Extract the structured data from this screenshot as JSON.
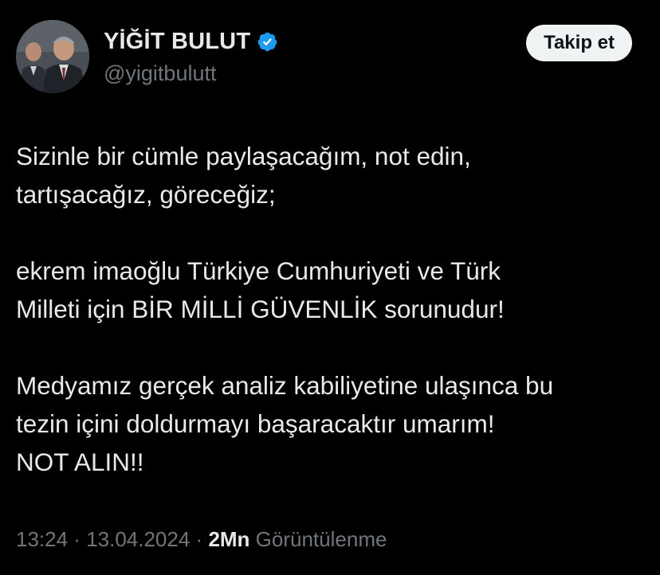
{
  "user": {
    "display_name": "YİĞİT BULUT",
    "handle": "@yigitbulutt",
    "verified_icon": "verified-badge-icon",
    "verified_color": "#1d9bf0"
  },
  "follow_button": {
    "label": "Takip et"
  },
  "tweet": {
    "lines_p1": [
      "Sizinle bir cümle paylaşacağım, not edin,",
      "tartışacağız, göreceğiz;"
    ],
    "lines_p2": [
      "ekrem imaoğlu Türkiye Cumhuriyeti ve Türk",
      "Milleti için BİR MİLLİ GÜVENLİK sorunudur!"
    ],
    "lines_p3": [
      "Medyamız gerçek analiz kabiliyetine ulaşınca bu",
      "tezin içini doldurmayı başaracaktır umarım!",
      "NOT ALIN!!"
    ]
  },
  "meta": {
    "time": "13:24",
    "separator": " · ",
    "date": "13.04.2024",
    "views_count": "2Mn",
    "views_label": "Görüntülenme"
  },
  "colors": {
    "background": "#000000",
    "text_primary": "#e7e9ea",
    "text_secondary": "#71767b",
    "button_bg": "#eff3f4"
  }
}
